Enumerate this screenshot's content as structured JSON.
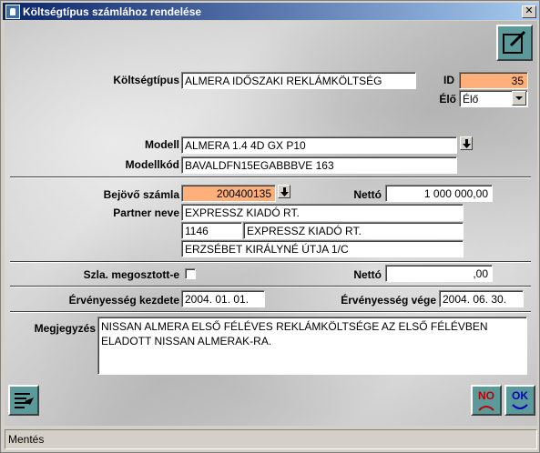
{
  "window": {
    "title": "Költségtípus számlához rendelése"
  },
  "form": {
    "koltsegtipus_label": "Költségtípus",
    "koltsegtipus_value": "ALMERA IDŐSZAKI REKLÁMKÖLTSÉG",
    "id_label": "ID",
    "id_value": "35",
    "elo_label": "Élő",
    "elo_value": "Élő",
    "modell_label": "Modell",
    "modell_value": "ALMERA 1.4 4D GX P10",
    "modellkod_label": "Modellkód",
    "modellkod_value": "BAVALDFN15EGABBBVE 163",
    "bejovo_szamla_label": "Bejövő számla",
    "bejovo_szamla_value": "200400135",
    "netto1_label": "Nettó",
    "netto1_value": "1 000 000,00",
    "partner_neve_label": "Partner neve",
    "partner_name": "EXPRESSZ KIADÓ RT.",
    "partner_zip": "1146",
    "partner_name2": "EXPRESSZ KIADÓ RT.",
    "partner_address": "ERZSÉBET KIRÁLYNÉ ÚTJA 1/C",
    "szla_megosztott_label": "Szla. megosztott-e",
    "netto2_label": "Nettó",
    "netto2_value": ",00",
    "ervenyesseg_kezdete_label": "Érvényesség kezdete",
    "ervenyesseg_kezdete_value": "2004. 01. 01.",
    "ervenyesseg_vege_label": "Érvényesség vége",
    "ervenyesseg_vege_value": "2004. 06. 30.",
    "megjegyzes_label": "Megjegyzés",
    "megjegyzes_value": "NISSAN ALMERA ELSŐ FÉLÉVES REKLÁMKÖLTSÉGE AZ ELSŐ FÉLÉVBEN ELADOTT NISSAN ALMERAK-RA."
  },
  "buttons": {
    "no_label": "NO",
    "ok_label": "OK"
  },
  "status": {
    "text": "Mentés"
  },
  "colors": {
    "highlight": "#ffb07a",
    "titlebar": "#0a246a"
  }
}
